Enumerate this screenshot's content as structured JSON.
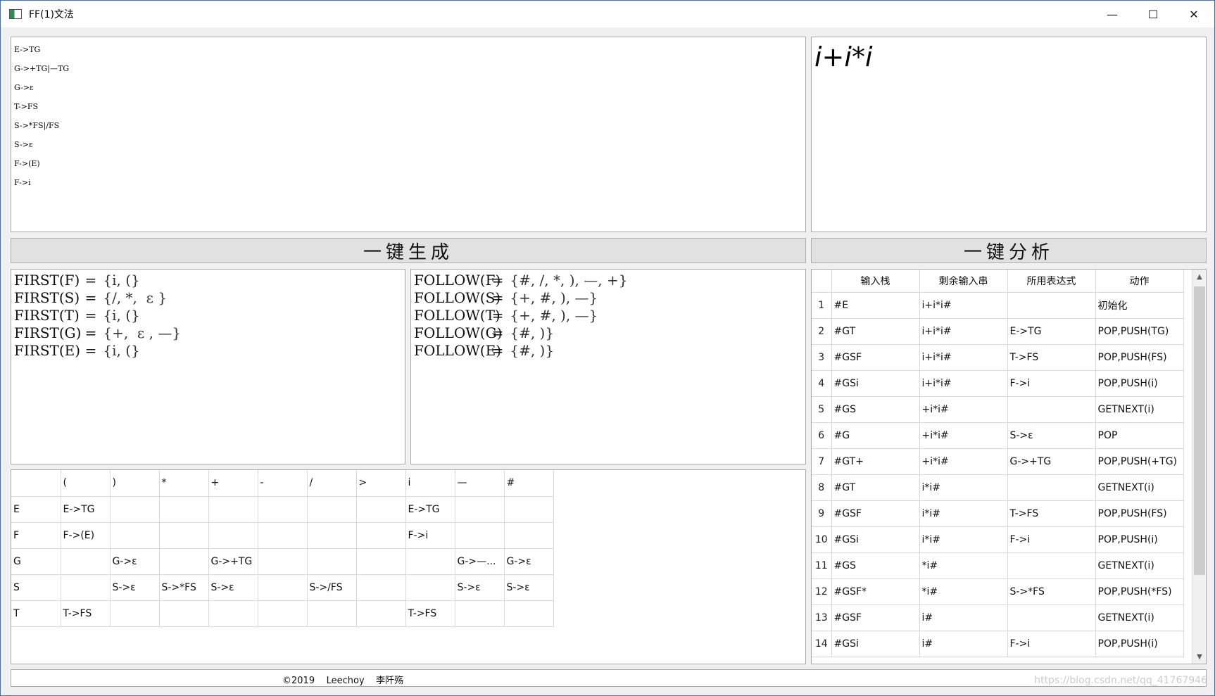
{
  "window": {
    "title": "FF(1)文法",
    "minimize_glyph": "—",
    "maximize_glyph": "☐",
    "close_glyph": "✕",
    "icon": "app-window-icon"
  },
  "grammar": {
    "lines": [
      "E->TG",
      "G->+TG|—TG",
      "G->ε",
      "T->FS",
      "S->*FS|/FS",
      "S->ε",
      "F->(E)",
      "F->i"
    ]
  },
  "input": {
    "expression": "i+i*i"
  },
  "buttons": {
    "generate": "一键生成",
    "analyze": "一键分析"
  },
  "first_sets": [
    {
      "name": "FIRST(F)",
      "eq": "=",
      "value": "{i, (}"
    },
    {
      "name": "FIRST(S)",
      "eq": "=",
      "value": "{/, *,  ε }"
    },
    {
      "name": "FIRST(T)",
      "eq": "=",
      "value": "{i, (}"
    },
    {
      "name": "FIRST(G)",
      "eq": "=",
      "value": "{+,  ε , —}"
    },
    {
      "name": "FIRST(E)",
      "eq": "=",
      "value": "{i, (}"
    }
  ],
  "follow_sets": [
    {
      "name": "FOLLOW(F)",
      "eq": "=",
      "value": "{#, /, *, ), —, +}"
    },
    {
      "name": "FOLLOW(S)",
      "eq": "=",
      "value": "{+, #, ), —}"
    },
    {
      "name": "FOLLOW(T)",
      "eq": "=",
      "value": "{+, #, ), —}"
    },
    {
      "name": "FOLLOW(G)",
      "eq": "=",
      "value": "{#, )}"
    },
    {
      "name": "FOLLOW(E)",
      "eq": "=",
      "value": "{#, )}"
    }
  ],
  "parse_table": {
    "header": [
      "",
      "(",
      ")",
      "*",
      "+",
      "-",
      "/",
      ">",
      "i",
      "—",
      "#"
    ],
    "rows": [
      [
        "E",
        "E->TG",
        "",
        "",
        "",
        "",
        "",
        "",
        "E->TG",
        "",
        ""
      ],
      [
        "F",
        "F->(E)",
        "",
        "",
        "",
        "",
        "",
        "",
        "F->i",
        "",
        ""
      ],
      [
        "G",
        "",
        "G->ε",
        "",
        "G->+TG",
        "",
        "",
        "",
        "",
        "G->—...",
        "G->ε"
      ],
      [
        "S",
        "",
        "S->ε",
        "S->*FS",
        "S->ε",
        "",
        "S->/FS",
        "",
        "",
        "S->ε",
        "S->ε"
      ],
      [
        "T",
        "T->FS",
        "",
        "",
        "",
        "",
        "",
        "",
        "T->FS",
        "",
        ""
      ]
    ]
  },
  "analysis_table": {
    "header": [
      "",
      "输入栈",
      "剩余输入串",
      "所用表达式",
      "动作"
    ],
    "rows": [
      [
        "1",
        "#E",
        "i+i*i#",
        "",
        "初始化"
      ],
      [
        "2",
        "#GT",
        "i+i*i#",
        "E->TG",
        "POP,PUSH(TG)"
      ],
      [
        "3",
        "#GSF",
        "i+i*i#",
        "T->FS",
        "POP,PUSH(FS)"
      ],
      [
        "4",
        "#GSi",
        "i+i*i#",
        "F->i",
        "POP,PUSH(i)"
      ],
      [
        "5",
        "#GS",
        "+i*i#",
        "",
        "GETNEXT(i)"
      ],
      [
        "6",
        "#G",
        "+i*i#",
        "S->ε",
        "POP"
      ],
      [
        "7",
        "#GT+",
        "+i*i#",
        "G->+TG",
        "POP,PUSH(+TG)"
      ],
      [
        "8",
        "#GT",
        "i*i#",
        "",
        "GETNEXT(i)"
      ],
      [
        "9",
        "#GSF",
        "i*i#",
        "T->FS",
        "POP,PUSH(FS)"
      ],
      [
        "10",
        "#GSi",
        "i*i#",
        "F->i",
        "POP,PUSH(i)"
      ],
      [
        "11",
        "#GS",
        "*i#",
        "",
        "GETNEXT(i)"
      ],
      [
        "12",
        "#GSF*",
        "*i#",
        "S->*FS",
        "POP,PUSH(*FS)"
      ],
      [
        "13",
        "#GSF",
        "i#",
        "",
        "GETNEXT(i)"
      ],
      [
        "14",
        "#GSi",
        "i#",
        "F->i",
        "POP,PUSH(i)"
      ]
    ]
  },
  "scrollbar": {
    "up_glyph": "▲",
    "down_glyph": "▼"
  },
  "status": {
    "text": "©2019    Leechoy    李阡殇"
  },
  "watermark": {
    "text": "https://blog.csdn.net/qq_41767946"
  }
}
